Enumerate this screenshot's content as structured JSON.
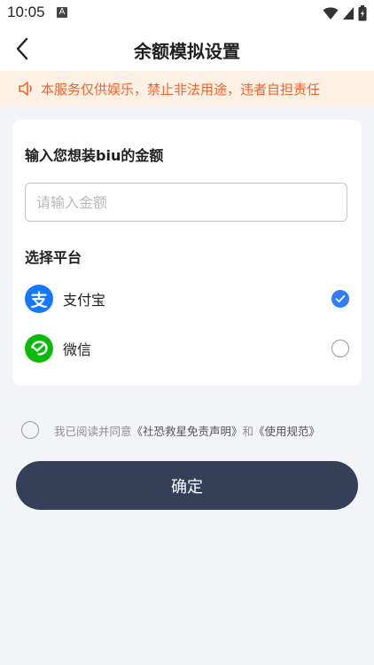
{
  "status_bar": {
    "time": "10:05",
    "badge": "A"
  },
  "nav": {
    "title": "余额模拟设置"
  },
  "notice": {
    "text": "本服务仅供娱乐，禁止非法用途，违者自担责任"
  },
  "form": {
    "amount_label": "输入您想装biu的金额",
    "amount_placeholder": "请输入金额",
    "amount_value": "",
    "platform_label": "选择平台",
    "platforms": [
      {
        "name": "支付宝",
        "logo_char": "支",
        "color": "#1677ff",
        "selected": true
      },
      {
        "name": "微信",
        "color": "#09bb07",
        "selected": false
      }
    ]
  },
  "agreement": {
    "prefix": "我已阅读并同意",
    "link1": "《社恐救星免责声明》",
    "joiner": "和",
    "link2": "《使用规范》",
    "checked": false
  },
  "confirm_label": "确定",
  "colors": {
    "accent": "#2f7cf6",
    "notice_text": "#f0642d",
    "notice_bg": "#fdf1e6",
    "button_bg": "#363f58"
  }
}
